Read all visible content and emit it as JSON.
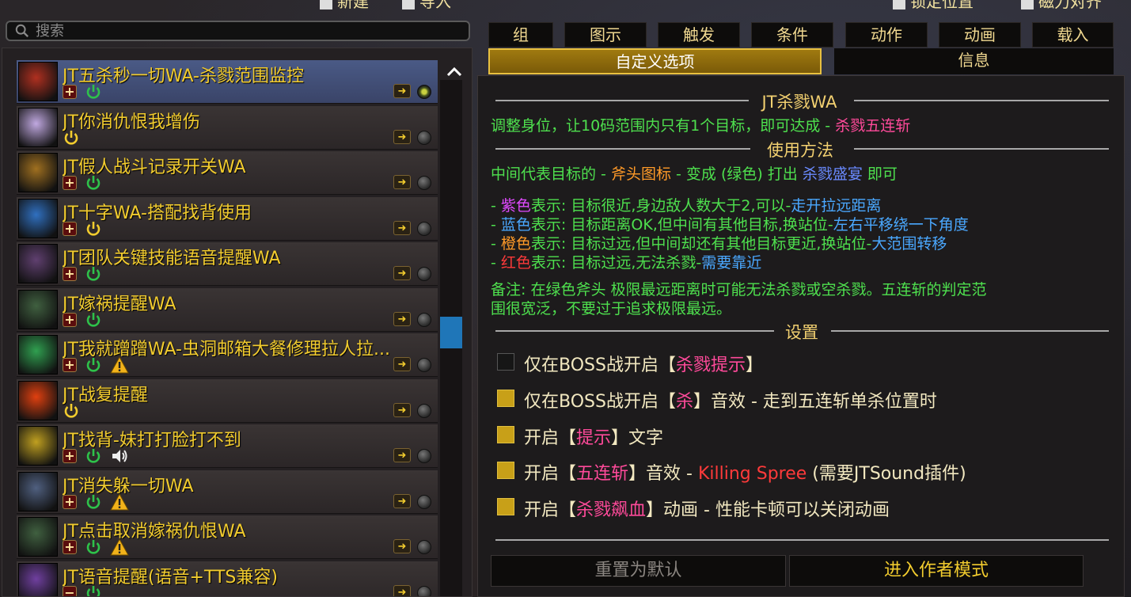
{
  "topbar": {
    "new_label": "新建",
    "import_label": "导入",
    "lock_label": "锁定位置",
    "magnet_label": "磁力对齐"
  },
  "search": {
    "placeholder": "搜索"
  },
  "list": {
    "items": [
      {
        "title": "JT五杀秒一切WA-杀戮范围监控",
        "plus": "+",
        "power": "green",
        "warn": false,
        "sound": false,
        "dot": "eye",
        "thumb": "#b03020"
      },
      {
        "title": "JT你消仇恨我增伤",
        "plus": "",
        "power": "yellow",
        "warn": false,
        "sound": false,
        "dot": "grey",
        "thumb": "#c0a8e0"
      },
      {
        "title": "JT假人战斗记录开关WA",
        "plus": "+",
        "power": "green",
        "warn": false,
        "sound": false,
        "dot": "grey",
        "thumb": "#a07020"
      },
      {
        "title": "JT十字WA-搭配找背使用",
        "plus": "+",
        "power": "yellow",
        "warn": false,
        "sound": false,
        "dot": "grey",
        "thumb": "#3070c0"
      },
      {
        "title": "JT团队关键技能语音提醒WA",
        "plus": "+",
        "power": "green",
        "warn": false,
        "sound": false,
        "dot": "grey",
        "thumb": "#604070"
      },
      {
        "title": "JT嫁祸提醒WA",
        "plus": "+",
        "power": "green",
        "warn": false,
        "sound": false,
        "dot": "grey",
        "thumb": "#406040"
      },
      {
        "title": "JT我就蹭蹭WA-虫洞邮箱大餐修理拉人拉...",
        "plus": "+",
        "power": "green",
        "warn": true,
        "sound": false,
        "dot": "grey",
        "thumb": "#30a050"
      },
      {
        "title": "JT战复提醒",
        "plus": "",
        "power": "yellow",
        "warn": false,
        "sound": false,
        "dot": "grey",
        "thumb": "#e04010"
      },
      {
        "title": "JT找背-妹打打脸打不到",
        "plus": "+",
        "power": "green",
        "warn": false,
        "sound": true,
        "dot": "grey",
        "thumb": "#c0a020"
      },
      {
        "title": "JT消失躲一切WA",
        "plus": "+",
        "power": "green",
        "warn": true,
        "sound": false,
        "dot": "grey",
        "thumb": "#506080"
      },
      {
        "title": "JT点击取消嫁祸仇恨WA",
        "plus": "+",
        "power": "green",
        "warn": true,
        "sound": false,
        "dot": "grey",
        "thumb": "#406040"
      },
      {
        "title": "JT语音提醒(语音+TTS兼容)",
        "plus": "−",
        "power": "green",
        "warn": false,
        "sound": false,
        "dot": "grey",
        "thumb": "#7040a0"
      }
    ]
  },
  "tabs_row1": [
    "组",
    "图示",
    "触发",
    "条件",
    "动作",
    "动画",
    "载入"
  ],
  "tabs_row2": {
    "custom": "自定义选项",
    "info": "信息"
  },
  "content": {
    "h1": "JT杀戮WA",
    "line1a": "调整身位，让10码范围内只有1个目标，即可达成 - ",
    "line1b": "杀戮五连斩",
    "h2": "使用方法",
    "line2a": "中间代表目标的 - ",
    "line2b": "斧头图标",
    "line2c": " - 变成 ",
    "line2d": "(绿色)",
    "line2e": " 打出 ",
    "line2f": "杀戮盛宴",
    "line2g": " 即可",
    "c1a": "- ",
    "c1b": "紫色",
    "c1c": "表示: 目标很近,身边敌人数大于2,可以-",
    "c1d": "走开拉远距离",
    "c2a": "- ",
    "c2b": "蓝色",
    "c2c": "表示: 目标距离OK,但中间有其他目标,换站位-",
    "c2d": "左右平移绕一下角度",
    "c3a": "- ",
    "c3b": "橙色",
    "c3c": "表示: 目标过远,但中间却还有其他目标更近,换站位-",
    "c3d": "大范围转移",
    "c4a": "- ",
    "c4b": "红色",
    "c4c": "表示: 目标过远,无法杀戮-",
    "c4d": "需要靠近",
    "note1": "备注: 在绿色斧头 极限最远距离时可能无法杀戮或空杀戮。五连斩的判定范",
    "note2": "围很宽泛，不要过于追求极限最远。",
    "h3": "设置",
    "opt1a": "仅在BOSS战开启【",
    "opt1b": "杀戮提示",
    "opt1c": "】",
    "opt2a": "仅在BOSS战开启【",
    "opt2b": "杀",
    "opt2c": "】音效 - 走到五连斩单杀位置时",
    "opt3a": "开启【",
    "opt3b": "提示",
    "opt3c": "】文字",
    "opt4a": "开启【",
    "opt4b": "五连斩",
    "opt4c": "】音效 - ",
    "opt4d": "Killing Spree",
    "opt4e": " (需要JTSound插件)",
    "opt5a": "开启【",
    "opt5b": "杀戮飙血",
    "opt5c": "】动画 - 性能卡顿可以关闭动画",
    "reset_label": "重置为默认",
    "author_label": "进入作者模式"
  },
  "colors": {
    "accent": "#f2cc2e",
    "selected_row": "#4a5a86",
    "scroll_thumb": "#1f76b8"
  }
}
